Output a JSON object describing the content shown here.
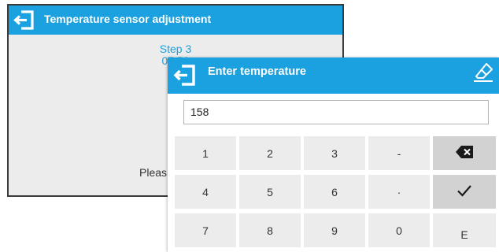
{
  "background_dialog": {
    "title": "Temperature sensor adjustment",
    "step": "Step 3",
    "time": "07:59",
    "instruction": "Pleas"
  },
  "input_dialog": {
    "title": "Enter temperature",
    "value": "158"
  },
  "keypad": {
    "rows": [
      [
        "1",
        "2",
        "3",
        "-",
        ""
      ],
      [
        "4",
        "5",
        "6",
        "·",
        ""
      ],
      [
        "7",
        "8",
        "9",
        "0",
        "E"
      ]
    ],
    "icons": {
      "backspace": "backspace-icon",
      "confirm": "checkmark-icon",
      "clear": "eraser-icon",
      "exit": "exit-icon"
    }
  },
  "colors": {
    "accent": "#1ca1e0",
    "key_bg": "#ececec",
    "key_bg_dark": "#d2d2d2",
    "dialog_bg": "#ececec"
  }
}
